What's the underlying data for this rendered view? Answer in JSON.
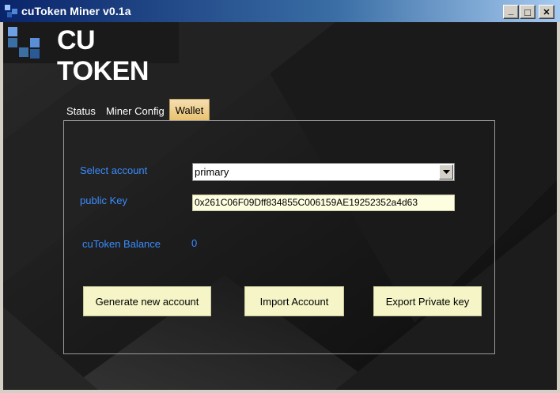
{
  "window": {
    "title": "cuToken Miner v0.1a",
    "buttons": {
      "minimize": "_",
      "maximize": "□",
      "close": "✕"
    }
  },
  "brand": {
    "logo_text": "CU TOKEN",
    "logo_color": "#3a6ea5"
  },
  "tabs": [
    {
      "label": "Status"
    },
    {
      "label": "Miner Config"
    },
    {
      "label": "Wallet",
      "selected": true
    }
  ],
  "wallet": {
    "select_account_label": "Select account",
    "selected_account": "primary",
    "public_key_label": "public Key",
    "public_key": "0x261C06F09Dff834855C006159AE19252352a4d63",
    "balance_label": "cuToken Balance",
    "balance_value": "0"
  },
  "actions": {
    "generate": "Generate new account",
    "import": "Import Account",
    "export": "Export Private key"
  },
  "colors": {
    "label": "#3a8cff",
    "button_bg": "#f5f5c8",
    "tab_selected_bg": "#e8c270",
    "titlebar_start": "#0a246a"
  }
}
